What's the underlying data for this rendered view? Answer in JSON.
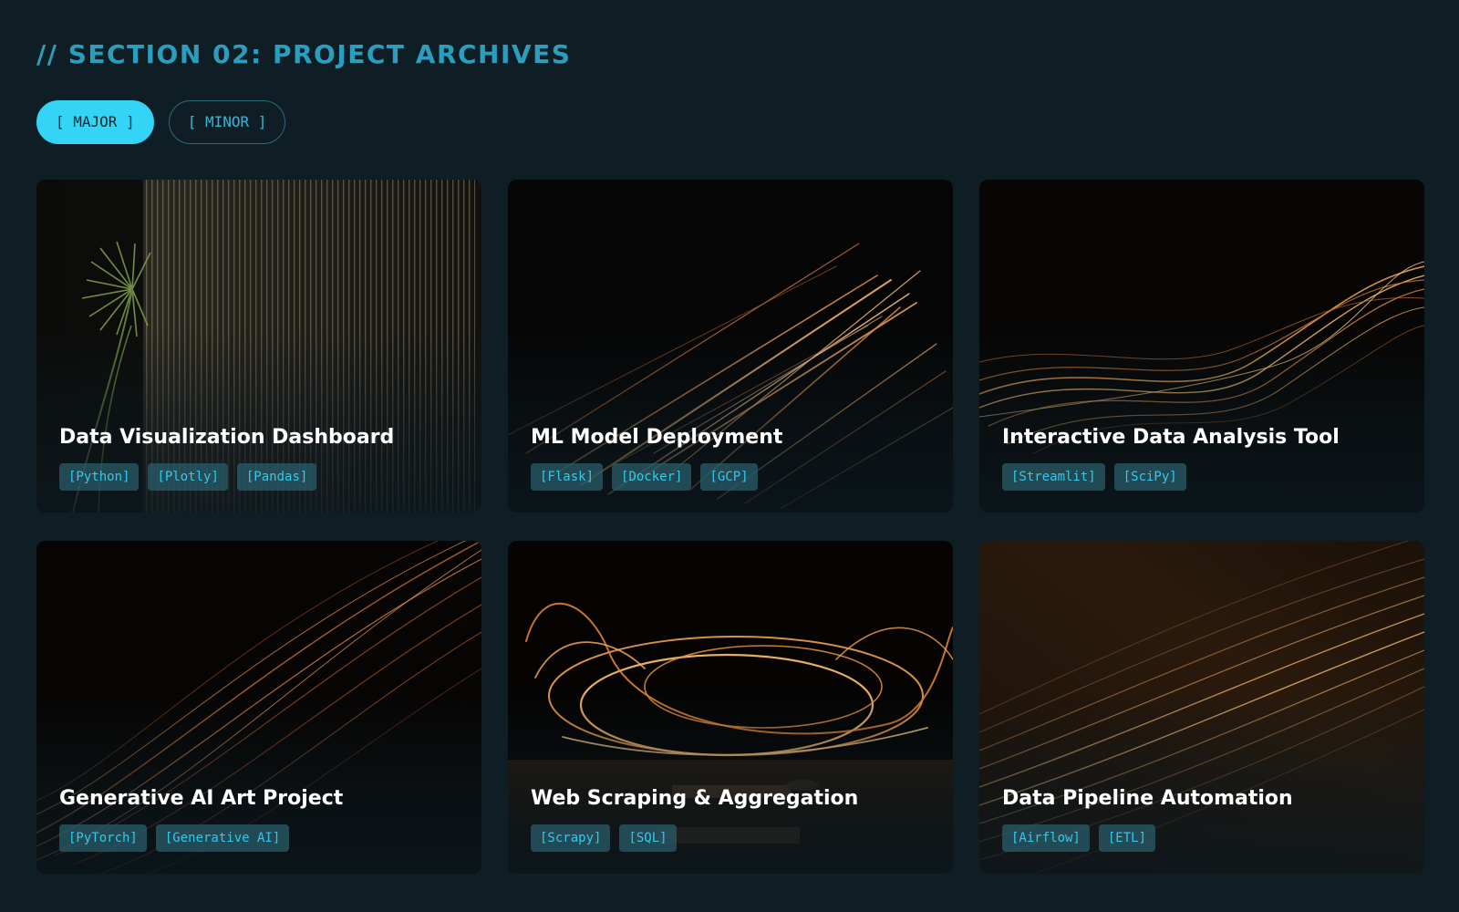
{
  "section": {
    "title": "// SECTION 02: PROJECT ARCHIVES"
  },
  "filters": [
    {
      "label": "[ MAJOR ]",
      "active": true
    },
    {
      "label": "[ MINOR ]",
      "active": false
    }
  ],
  "colors": {
    "background": "#0f1e24",
    "accent": "#33d4f6",
    "title_teal": "#2b9dbd",
    "tag_text": "#34c8ea"
  },
  "projects": [
    {
      "title": "Data Visualization Dashboard",
      "tags": [
        "[Python]",
        "[Plotly]",
        "[Pandas]"
      ],
      "image": "vertical-light-bars-with-palm"
    },
    {
      "title": "ML Model Deployment",
      "tags": [
        "[Flask]",
        "[Docker]",
        "[GCP]"
      ],
      "image": "diagonal-light-streaks"
    },
    {
      "title": "Interactive Data Analysis Tool",
      "tags": [
        "[Streamlit]",
        "[SciPy]"
      ],
      "image": "wavy-light-trails"
    },
    {
      "title": "Generative AI Art Project",
      "tags": [
        "[PyTorch]",
        "[Generative AI]"
      ],
      "image": "sweeping-light-curves"
    },
    {
      "title": "Web Scraping & Aggregation",
      "tags": [
        "[Scrapy]",
        "[SQL]"
      ],
      "image": "swirling-light-loops"
    },
    {
      "title": "Data Pipeline Automation",
      "tags": [
        "[Airflow]",
        "[ETL]"
      ],
      "image": "dense-light-strands"
    }
  ]
}
